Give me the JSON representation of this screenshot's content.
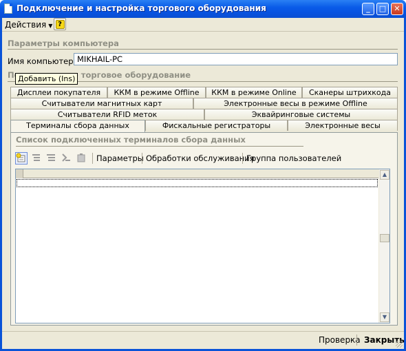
{
  "window": {
    "title": "Подключение и настройка торгового оборудования",
    "buttons": {
      "minimize": "_",
      "maximize": "□",
      "close": "✕"
    }
  },
  "menubar": {
    "actions_label": "Действия",
    "help_label": "?"
  },
  "computer_params": {
    "section_title": "Параметры компьютера",
    "computer_name_label": "Имя компьютера:",
    "computer_name_value": "MIKHAIL-PC"
  },
  "equipment": {
    "section_title": "Подключаемое торговое оборудование",
    "tab_rows": [
      [
        "Дисплеи покупателя",
        "ККМ в режиме Offline",
        "ККМ в режиме Online",
        "Сканеры штрихкода"
      ],
      [
        "Считыватели магнитных карт",
        "Электронные весы в режиме Offline"
      ],
      [
        "Считыватели RFID меток",
        "Эквайринговые системы"
      ],
      [
        "Терминалы сбора данных",
        "Фискальные регистраторы",
        "Электронные весы"
      ]
    ],
    "active_tab": "Терминалы сбора данных"
  },
  "panel": {
    "list_title": "Список подключенных терминалов сбора данных",
    "toolbar": {
      "icons": [
        "add-icon",
        "add-copy-icon",
        "edit-icon",
        "delete-icon",
        "mark-delete-icon"
      ],
      "params_label": "Параметры",
      "service_label": "Обработки обслуживания",
      "user_group_label": "Группа пользователей"
    },
    "tooltip": "Добавить (Ins)"
  },
  "footer": {
    "check_label": "Проверка",
    "close_label": "Закрыть"
  },
  "colors": {
    "titlebar": "#0a5ce8",
    "face": "#ece9d8",
    "panel": "#f6f4ea",
    "section_text": "#8f8f84"
  }
}
